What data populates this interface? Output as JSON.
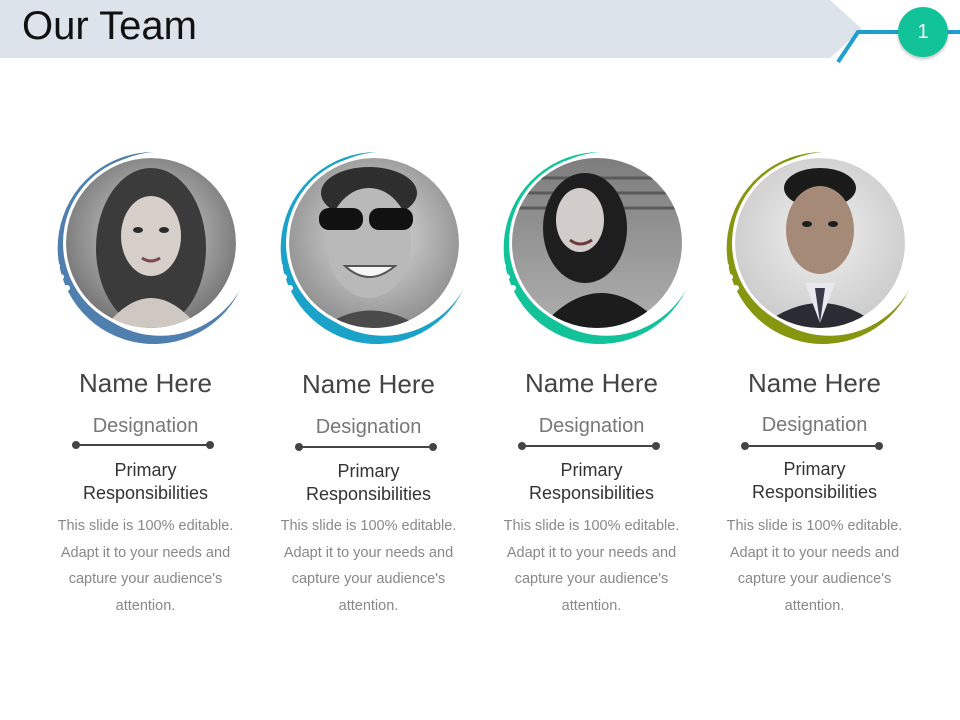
{
  "slide": {
    "title": "Our Team",
    "page_number": "1"
  },
  "colors": {
    "banner": "#dde3eb",
    "connector": "#1f9fcf",
    "badge": "#12c39a"
  },
  "members": [
    {
      "name": "Name Here",
      "designation": "Designation",
      "responsibility_line1": "Primary",
      "responsibility_line2": "Responsibilities",
      "text": "This slide is 100% editable. Adapt it to your needs and capture your audience's attention.",
      "ring_color": "#4f7fae",
      "photo": "woman-portrait"
    },
    {
      "name": "Name Here",
      "designation": "Designation",
      "responsibility_line1": "Primary",
      "responsibility_line2": "Responsibilities",
      "text": "This slide is 100% editable. Adapt it to your needs and capture your audience's attention.",
      "ring_color": "#1aa2c9",
      "photo": "man-sunglasses-portrait"
    },
    {
      "name": "Name Here",
      "designation": "Designation",
      "responsibility_line1": "Primary",
      "responsibility_line2": "Responsibilities",
      "text": "This slide is 100% editable. Adapt it to your needs and capture your audience's attention.",
      "ring_color": "#12c39a",
      "photo": "woman-leather-jacket-portrait"
    },
    {
      "name": "Name Here",
      "designation": "Designation",
      "responsibility_line1": "Primary",
      "responsibility_line2": "Responsibilities",
      "text": "This slide is 100% editable. Adapt it to your needs and capture your audience's attention.",
      "ring_color": "#86960f",
      "photo": "man-suit-portrait"
    }
  ]
}
